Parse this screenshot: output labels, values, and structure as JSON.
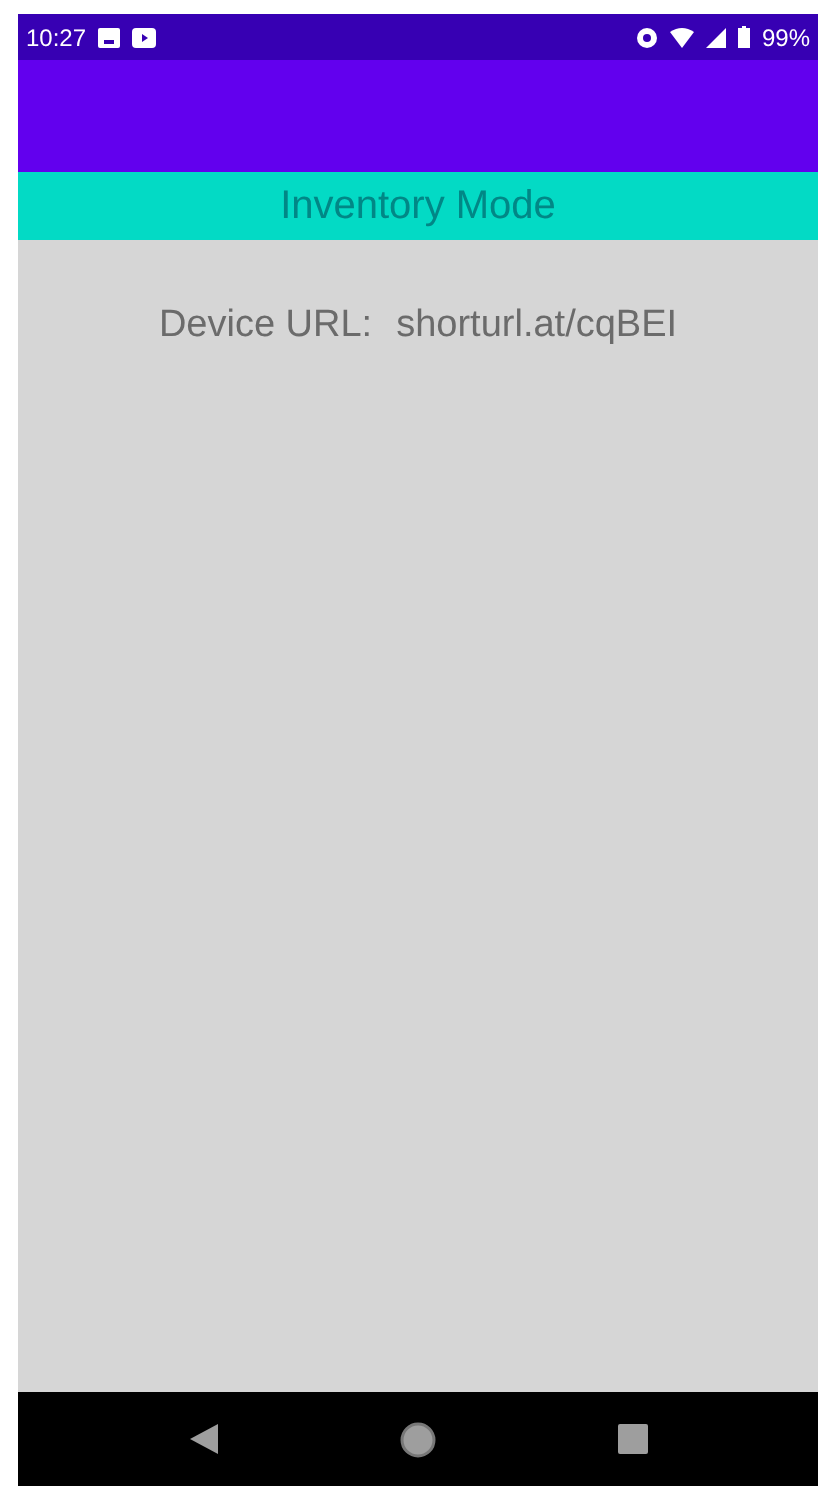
{
  "status_bar": {
    "time": "10:27",
    "battery": "99%"
  },
  "mode_banner": {
    "title": "Inventory Mode"
  },
  "content": {
    "label": "Device URL:",
    "value": "shorturl.at/cqBEI"
  }
}
